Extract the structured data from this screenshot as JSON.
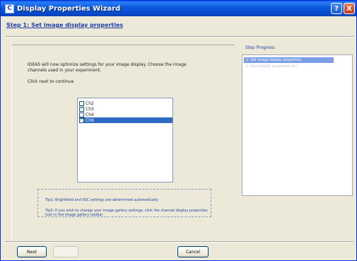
{
  "window": {
    "title": "Display Properties Wizard",
    "app_icon_letter": "C",
    "help_glyph": "?",
    "close_glyph": "X"
  },
  "step_header": "Step 1: Set image display properties",
  "instructions": "IDEAS will now optimize settings for your image display.  Choose the image channels used in your experiment.",
  "continue_text": "Click next to continue",
  "channels": [
    {
      "label": "Ch2",
      "checked": false,
      "selected": false
    },
    {
      "label": "Ch3",
      "checked": true,
      "selected": false
    },
    {
      "label": "Ch4",
      "checked": false,
      "selected": false
    },
    {
      "label": "Ch6",
      "checked": true,
      "selected": true
    }
  ],
  "tips": {
    "tip1": "Tip1: Brightfield and SSC settings are determined automatically",
    "tip2": "Tip2: If you wish to change your image gallery settings, click the channel display properties icon in the image gallery toolbar"
  },
  "step_progress": {
    "title": "Step Progress:",
    "items": [
      {
        "label": "1: Set image display properties",
        "state": "current"
      },
      {
        "label": "2: Exit display properties wiz",
        "state": "pending"
      }
    ]
  },
  "buttons": {
    "next": "Next",
    "back": "",
    "cancel": "Cancel"
  },
  "colors": {
    "title_bar": "#0a58dd",
    "selection": "#316ac5",
    "link_text": "#1f3fa8"
  }
}
